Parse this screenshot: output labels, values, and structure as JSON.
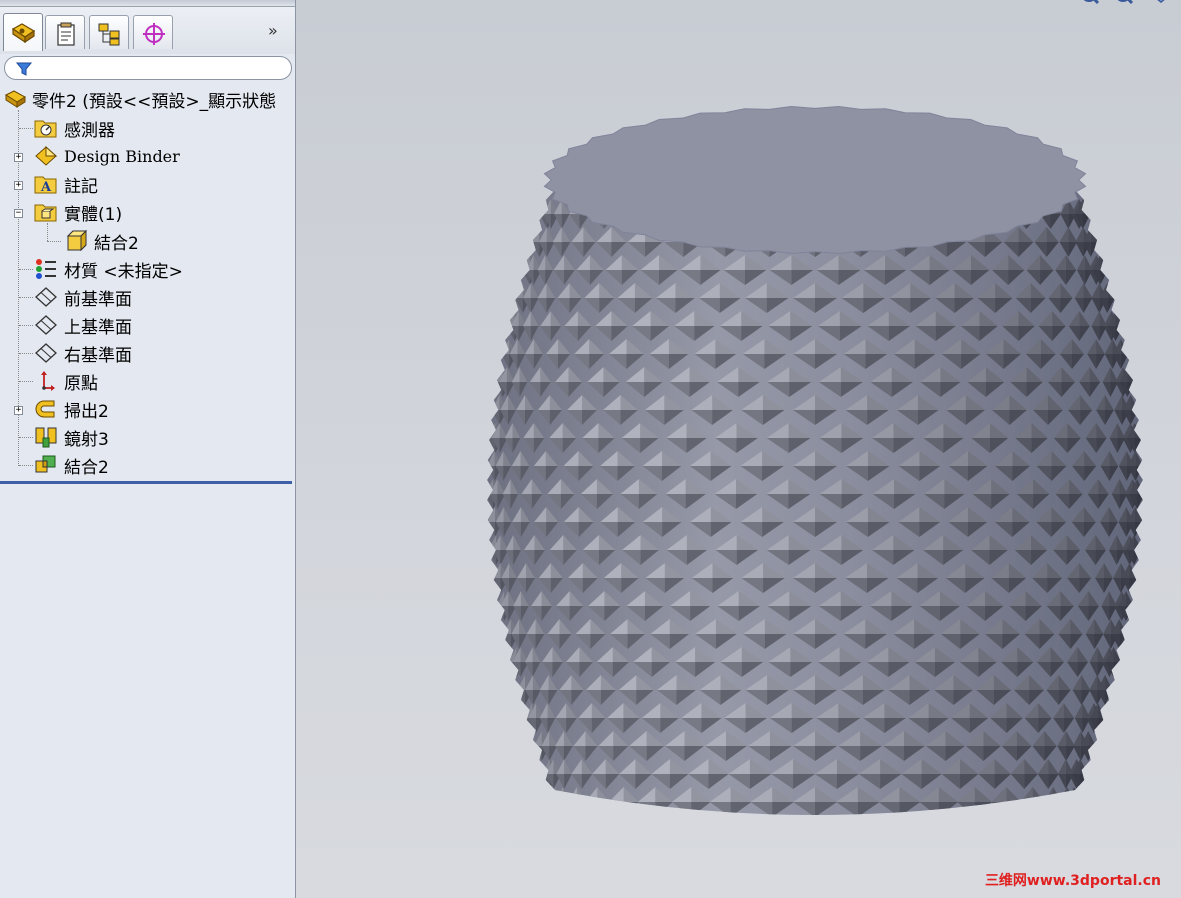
{
  "tabs": {
    "items": [
      {
        "name": "feature-manager-icon",
        "active": true
      },
      {
        "name": "property-manager-icon",
        "active": false
      },
      {
        "name": "configuration-manager-icon",
        "active": false
      },
      {
        "name": "dimxpert-manager-icon",
        "active": false
      }
    ],
    "expand_glyph": "»"
  },
  "filter": {
    "icon": "filter-icon"
  },
  "tree": {
    "root_label": "零件2  (預設<<預設>_顯示狀態",
    "items": [
      {
        "label": "感測器",
        "icon": "sensors-folder-icon"
      },
      {
        "label": "Design Binder",
        "icon": "design-binder-icon"
      },
      {
        "label": "註記",
        "icon": "annotations-folder-icon"
      },
      {
        "label": "實體(1)",
        "icon": "solid-bodies-folder-icon"
      },
      {
        "label": "結合2",
        "icon": "solid-body-icon"
      },
      {
        "label": "材質 <未指定>",
        "icon": "material-icon"
      },
      {
        "label": "前基準面",
        "icon": "plane-icon"
      },
      {
        "label": "上基準面",
        "icon": "plane-icon"
      },
      {
        "label": "右基準面",
        "icon": "plane-icon"
      },
      {
        "label": "原點",
        "icon": "origin-icon"
      },
      {
        "label": "掃出2",
        "icon": "sweep-feature-icon"
      },
      {
        "label": "鏡射3",
        "icon": "mirror-feature-icon"
      },
      {
        "label": "結合2",
        "icon": "combine-feature-icon"
      }
    ]
  },
  "viewport": {
    "model": "knurled-barrel-part",
    "hud_icons": [
      "zoom-to-fit-icon",
      "zoom-to-area-icon",
      "view-orientation-icon"
    ],
    "watermark": "三维网www.3dportal.cn"
  },
  "colors": {
    "panel_bg": "#e4e8f0",
    "viewport_bg": "#cfd3db",
    "model_face": "#8e92a3",
    "tree_end_line": "#3f5ea8",
    "watermark": "#e02020"
  }
}
